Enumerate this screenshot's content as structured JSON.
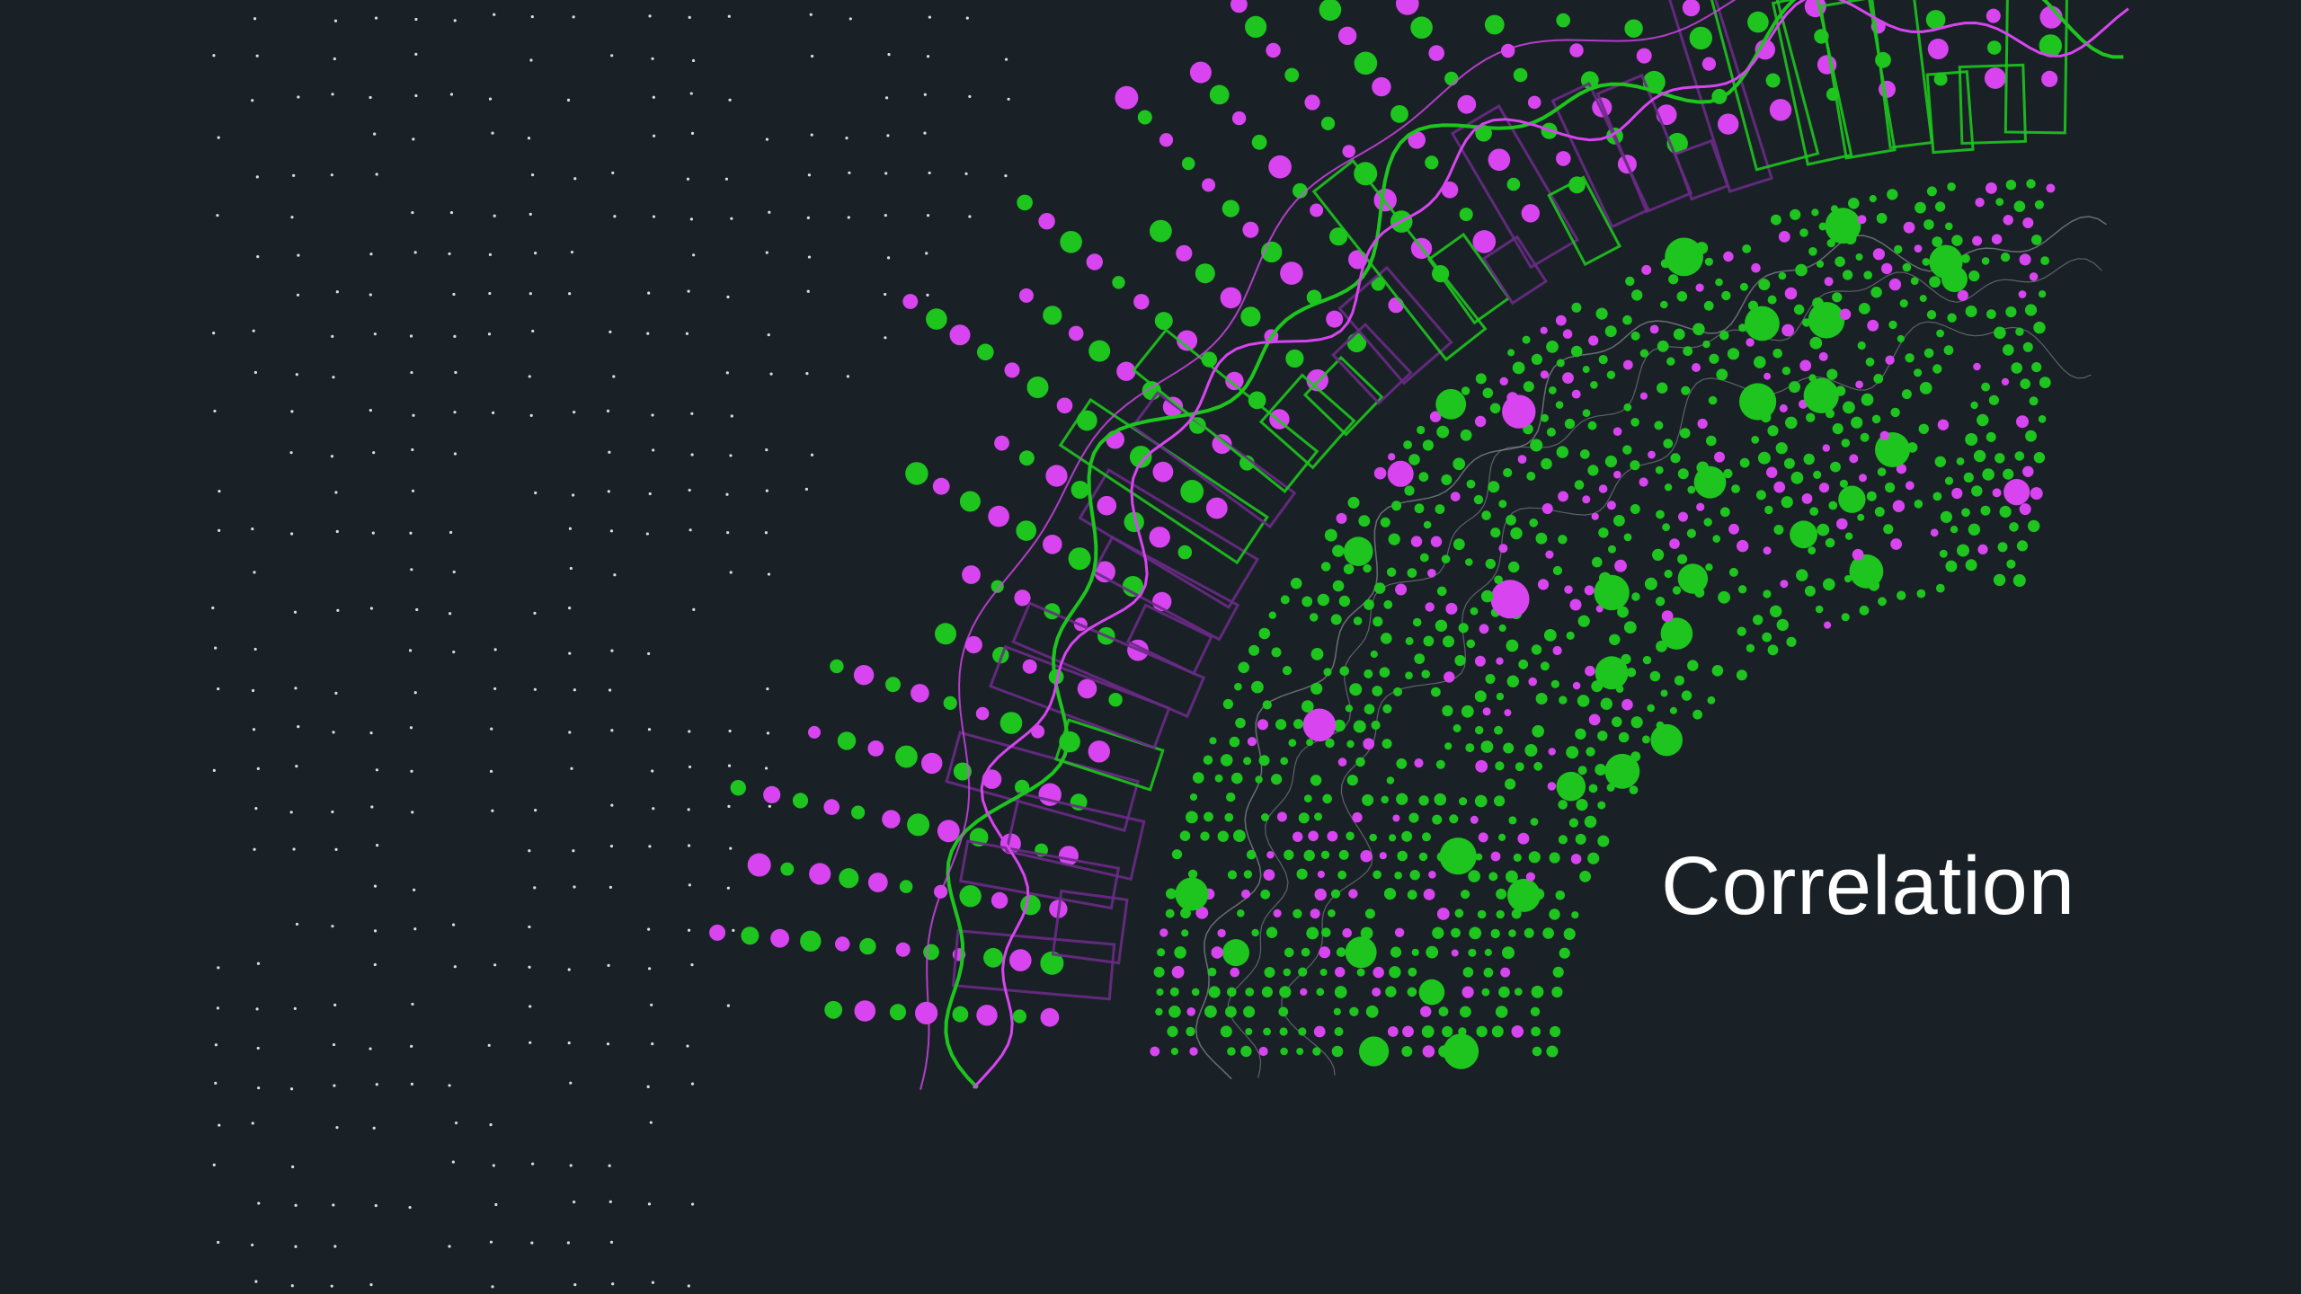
{
  "slide": {
    "title": "Correlation"
  },
  "colors": {
    "background": "#192127",
    "title_text": "#ffffff",
    "green": "#1ec51e",
    "magenta": "#d845f0",
    "dim_magenta": "#6a2a86",
    "thin_line": "#8a8f94",
    "star": "#ffffff"
  }
}
